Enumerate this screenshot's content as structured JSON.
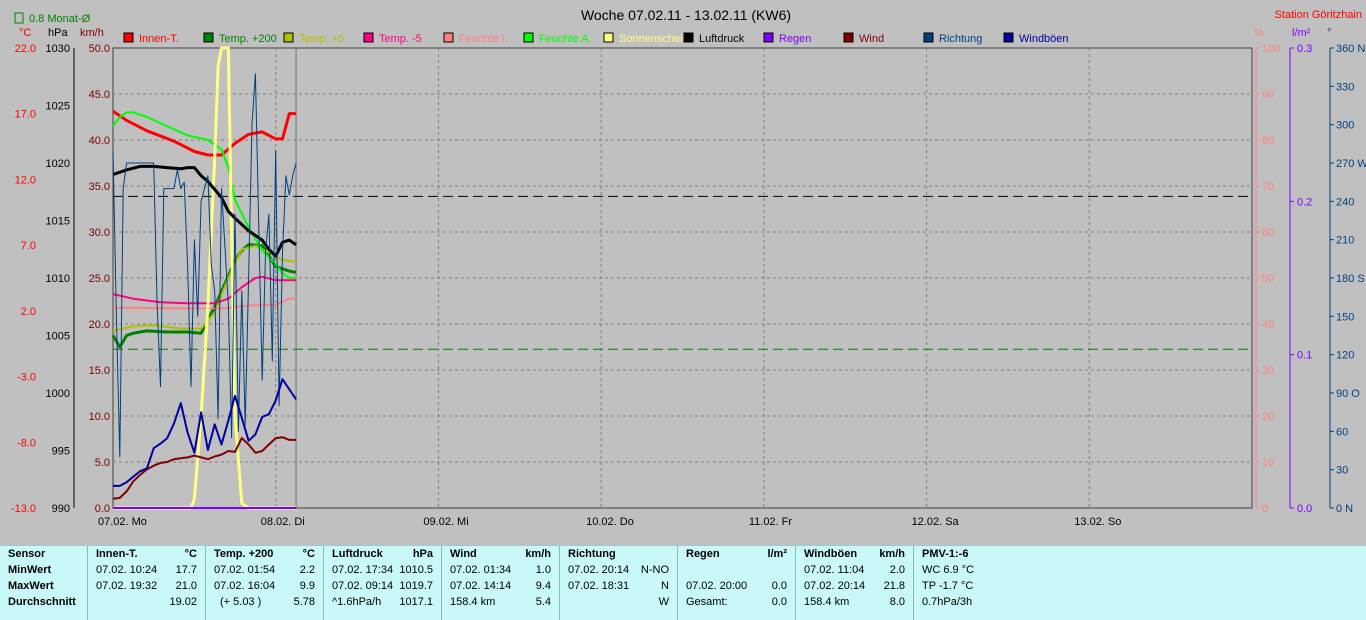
{
  "title": "Woche 07.02.11 - 13.02.11 (KW6)",
  "station": "Station Göritzhain",
  "monthly_avg_label": "0.8 Monat-Ø",
  "left_units": [
    "°C",
    "hPa",
    "km/h"
  ],
  "right_units": [
    "%",
    "l/m²",
    "°"
  ],
  "colors": {
    "plot_bg": "#c0c0c0",
    "grid": "#808080",
    "innen": "#ff0000",
    "temp200": "#008000",
    "temp5": "#b0c000",
    "tempm5": "#ff0080",
    "feuchte_i": "#ff8080",
    "feuchte_a": "#00ff00",
    "sonne": "#ffff80",
    "luftdruck": "#000000",
    "regen": "#8000ff",
    "wind": "#800000",
    "richtung": "#004080",
    "windboeen": "#0000a0"
  },
  "chart_data": {
    "type": "line",
    "title": "Woche 07.02.11 - 13.02.11 (KW6)",
    "x_labels": [
      "07.02. Mo",
      "08.02. Di",
      "09.02. Mi",
      "10.02. Do",
      "11.02. Fr",
      "12.02. Sa",
      "13.02. So"
    ],
    "xlim_hours": [
      0,
      168
    ],
    "axes": {
      "temp_c": {
        "ticks": [
          "22.0",
          "17.0",
          "12.0",
          "7.0",
          "2.0",
          "-3.0",
          "-8.0",
          "-13.0"
        ],
        "ylim": [
          -13,
          27
        ]
      },
      "pressure_hpa": {
        "ticks": [
          "1030",
          "1025",
          "1020",
          "1015",
          "1010",
          "1005",
          "1000",
          "995",
          "990"
        ],
        "ylim": [
          990,
          1030
        ]
      },
      "speed_kmh": {
        "ticks": [
          "50.0",
          "45.0",
          "40.0",
          "35.0",
          "30.0",
          "25.0",
          "20.0",
          "15.0",
          "10.0",
          "5.0",
          "0.0"
        ],
        "ylim": [
          0,
          50
        ]
      },
      "humidity_pct": {
        "ticks": [
          "100",
          "90",
          "80",
          "70",
          "60",
          "50",
          "40",
          "30",
          "20",
          "10",
          "0"
        ],
        "ylim": [
          0,
          100
        ]
      },
      "rain_lm2": {
        "ticks": [
          "0.3",
          "0.2",
          "0.1",
          "0.0"
        ],
        "ylim": [
          0,
          0.3
        ]
      },
      "direction_deg": {
        "ticks": [
          "360 N",
          "330",
          "300",
          "270 W",
          "240",
          "210",
          "180 S",
          "150",
          "120",
          "90 O",
          "60",
          "30",
          "0 N"
        ],
        "ylim": [
          0,
          360
        ]
      }
    },
    "reference_lines": [
      {
        "name": "Luftdruck Ø",
        "axis": "pressure_hpa",
        "y": 1017.1,
        "color": "#000000"
      },
      {
        "name": "0.8 Monat-Ø",
        "axis": "temp_c",
        "y": 0.8,
        "color": "#008000"
      }
    ],
    "series": [
      {
        "name": "Innen-T.",
        "color": "#ff0000",
        "axis": "temp_c",
        "width": 3,
        "x": [
          0,
          2,
          5,
          9,
          12,
          14,
          16,
          18,
          20,
          22,
          24,
          25,
          26,
          27
        ],
        "y": [
          21.5,
          20.7,
          19.8,
          18.9,
          18.0,
          17.7,
          17.7,
          18.7,
          19.5,
          19.7,
          19.1,
          19.1,
          21.3,
          21.3
        ]
      },
      {
        "name": "Temp. +200",
        "color": "#008000",
        "axis": "temp_c",
        "width": 3,
        "x": [
          0,
          1,
          2,
          3,
          5,
          8,
          11,
          13,
          15,
          16.5,
          18,
          19,
          20,
          22,
          23,
          24,
          25,
          26,
          27
        ],
        "y": [
          2.0,
          1.0,
          2.0,
          2.2,
          2.4,
          2.3,
          2.3,
          2.2,
          4.5,
          6.5,
          8.5,
          9.4,
          9.9,
          9.8,
          8.9,
          8.0,
          7.8,
          7.6,
          7.5
        ]
      },
      {
        "name": "Temp. +5",
        "color": "#b0c000",
        "axis": "temp_c",
        "width": 2,
        "x": [
          0,
          3,
          6,
          10,
          13,
          15,
          17,
          19,
          21,
          23,
          25,
          27
        ],
        "y": [
          2.4,
          2.8,
          2.9,
          2.6,
          2.6,
          4.0,
          7.0,
          9.5,
          9.8,
          9.2,
          8.6,
          8.4
        ]
      },
      {
        "name": "Temp. -5",
        "color": "#ff0080",
        "axis": "temp_c",
        "width": 2,
        "x": [
          0,
          3,
          7,
          11,
          15,
          17,
          19,
          21,
          22,
          24,
          26,
          27
        ],
        "y": [
          5.6,
          5.2,
          4.9,
          4.8,
          4.8,
          5.2,
          6.2,
          7.0,
          7.1,
          6.8,
          6.8,
          6.8
        ]
      },
      {
        "name": "Feuchte I.",
        "color": "#ff8080",
        "axis": "humidity_pct",
        "width": 2,
        "x": [
          0,
          4,
          8,
          12,
          16,
          20,
          24,
          26,
          27
        ],
        "y": [
          43.5,
          43.5,
          43.4,
          43.4,
          43.4,
          44.0,
          44.2,
          45.5,
          45.5
        ]
      },
      {
        "name": "Feuchte A.",
        "color": "#00ff00",
        "axis": "humidity_pct",
        "width": 2,
        "x": [
          0,
          1,
          2,
          3,
          5,
          8,
          11,
          14,
          16,
          17,
          18,
          20,
          22,
          24,
          25,
          26,
          27
        ],
        "y": [
          83,
          85,
          86,
          86,
          85,
          83,
          81,
          80,
          78,
          74,
          67,
          61,
          56,
          53,
          51,
          50,
          50
        ]
      },
      {
        "name": "Sonnenschein",
        "color": "#ffff80",
        "axis": "speed_kmh",
        "width": 3,
        "x": [
          0,
          11.5,
          12,
          13,
          14,
          15,
          15.5,
          16,
          16.5,
          17,
          17.5,
          18,
          19,
          20,
          21,
          24,
          27
        ],
        "y": [
          0,
          0,
          1,
          10,
          22,
          38,
          48,
          50,
          50,
          50,
          30,
          10,
          0.5,
          0,
          0,
          0,
          0
        ]
      },
      {
        "name": "Luftdruck",
        "color": "#000000",
        "axis": "pressure_hpa",
        "width": 3,
        "x": [
          0,
          2,
          4,
          6,
          8,
          10,
          11,
          12,
          13,
          14,
          16,
          17,
          18,
          20,
          22,
          23,
          24,
          25,
          26,
          27
        ],
        "y": [
          1019.0,
          1019.4,
          1019.7,
          1019.7,
          1019.6,
          1019.5,
          1019.6,
          1019.6,
          1018.9,
          1018.4,
          1017.0,
          1015.8,
          1015.2,
          1014.1,
          1013.3,
          1012.5,
          1011.9,
          1013.1,
          1013.3,
          1012.9
        ]
      },
      {
        "name": "Regen",
        "color": "#8000ff",
        "axis": "rain_lm2",
        "width": 2,
        "x": [
          0,
          27
        ],
        "y": [
          0,
          0
        ]
      },
      {
        "name": "Wind",
        "color": "#800000",
        "axis": "speed_kmh",
        "width": 2,
        "x": [
          0,
          1,
          2,
          3,
          4,
          5,
          6,
          7,
          8,
          9,
          10,
          11,
          12,
          13,
          14,
          15,
          16,
          17,
          18,
          19,
          20,
          21,
          22,
          23,
          24,
          25,
          26,
          27
        ],
        "y": [
          1.0,
          1.1,
          1.8,
          2.9,
          3.6,
          4.2,
          4.6,
          4.9,
          5.0,
          5.3,
          5.4,
          5.5,
          5.7,
          5.5,
          5.3,
          5.6,
          5.8,
          6.2,
          6.1,
          7.6,
          6.9,
          6.0,
          6.2,
          6.9,
          7.6,
          7.7,
          7.4,
          7.4
        ]
      },
      {
        "name": "Richtung",
        "color": "#004080",
        "axis": "direction_deg",
        "width": 1,
        "x": [
          0,
          0.5,
          1,
          1.5,
          2,
          2.5,
          3,
          4,
          5,
          6,
          6.5,
          7,
          7.5,
          8,
          9,
          9.5,
          10,
          10.5,
          11,
          11.5,
          12,
          12.5,
          13,
          14,
          14.5,
          15,
          15.5,
          16,
          17,
          17.5,
          18,
          18.5,
          19,
          19.5,
          20,
          20.5,
          21,
          21.5,
          22,
          22.5,
          23,
          23.5,
          24,
          24.5,
          25,
          25.5,
          26,
          26.5,
          27
        ],
        "y": [
          280,
          150,
          40,
          250,
          270,
          270,
          270,
          270,
          270,
          270,
          160,
          95,
          250,
          250,
          250,
          265,
          250,
          255,
          190,
          95,
          210,
          150,
          240,
          260,
          190,
          170,
          70,
          250,
          160,
          55,
          230,
          60,
          170,
          65,
          180,
          300,
          340,
          220,
          100,
          200,
          230,
          115,
          280,
          80,
          200,
          260,
          245,
          260,
          270
        ]
      },
      {
        "name": "Windböen",
        "color": "#0000a0",
        "axis": "speed_kmh",
        "width": 2,
        "x": [
          0,
          1,
          2,
          3,
          4,
          5,
          6,
          7,
          8,
          9,
          10,
          11,
          12,
          13,
          14,
          15,
          16,
          17,
          18,
          19,
          20,
          21,
          22,
          23,
          24,
          25,
          26,
          27
        ],
        "y": [
          2.4,
          2.4,
          2.8,
          3.4,
          4.0,
          4.3,
          6.5,
          7.0,
          7.6,
          9.2,
          11.4,
          8.2,
          6.0,
          10.4,
          6.3,
          9.1,
          6.9,
          9.5,
          12.2,
          9.8,
          7.3,
          8.0,
          9.9,
          10.2,
          11.7,
          14.0,
          12.9,
          11.8
        ]
      }
    ]
  },
  "stats": {
    "sensor": {
      "header": "Sensor",
      "min": "MinWert",
      "max": "MaxWert",
      "avg": "Durchschnitt"
    },
    "innen": {
      "header": "Innen-T.",
      "unit": "°C",
      "min_time": "07.02.  10:24",
      "min_val": "17.7",
      "max_time": "07.02.  19:32",
      "max_val": "21.0",
      "avg_val": "19.02"
    },
    "temp200": {
      "header": "Temp. +200",
      "unit": "°C",
      "min_time": "07.02.  01:54",
      "min_val": "2.2",
      "max_time": "07.02.  16:04",
      "max_val": "9.9",
      "avg_note": "(+ 5.03 )",
      "avg_val": "5.78"
    },
    "luftdruck": {
      "header": "Luftdruck",
      "unit": "hPa",
      "min_time": "07.02.  17:34",
      "min_val": "1010.5",
      "max_time": "07.02.  09:14",
      "max_val": "1019.7",
      "avg_note": "^1.6hPa/h",
      "avg_val": "1017.1"
    },
    "wind": {
      "header": "Wind",
      "unit": "km/h",
      "min_time": "07.02.  01:34",
      "min_val": "1.0",
      "max_time": "07.02.  14:14",
      "max_val": "9.4",
      "avg_note": "158.4 km",
      "avg_val": "5.4"
    },
    "richtung": {
      "header": "Richtung",
      "min_time": "07.02.  20:14",
      "min_val": "N-NO",
      "max_time": "07.02.  18:31",
      "max_val": "N",
      "avg_val": "W"
    },
    "regen": {
      "header": "Regen",
      "unit": "l/m²",
      "max_time": "07.02.  20:00",
      "max_val": "0.0",
      "avg_note": "Gesamt:",
      "avg_val": "0.0"
    },
    "windboeen": {
      "header": "Windböen",
      "unit": "km/h",
      "min_time": "07.02.  11:04",
      "min_val": "2.0",
      "max_time": "07.02.  20:14",
      "max_val": "21.8",
      "avg_note": "158.4 km",
      "avg_val": "8.0"
    },
    "pmv": {
      "header": "PMV-1:-6",
      "min_val": "WC 6.9 °C",
      "max_val": "TP -1.7 °C",
      "avg_val": "0.7hPa/3h"
    }
  }
}
